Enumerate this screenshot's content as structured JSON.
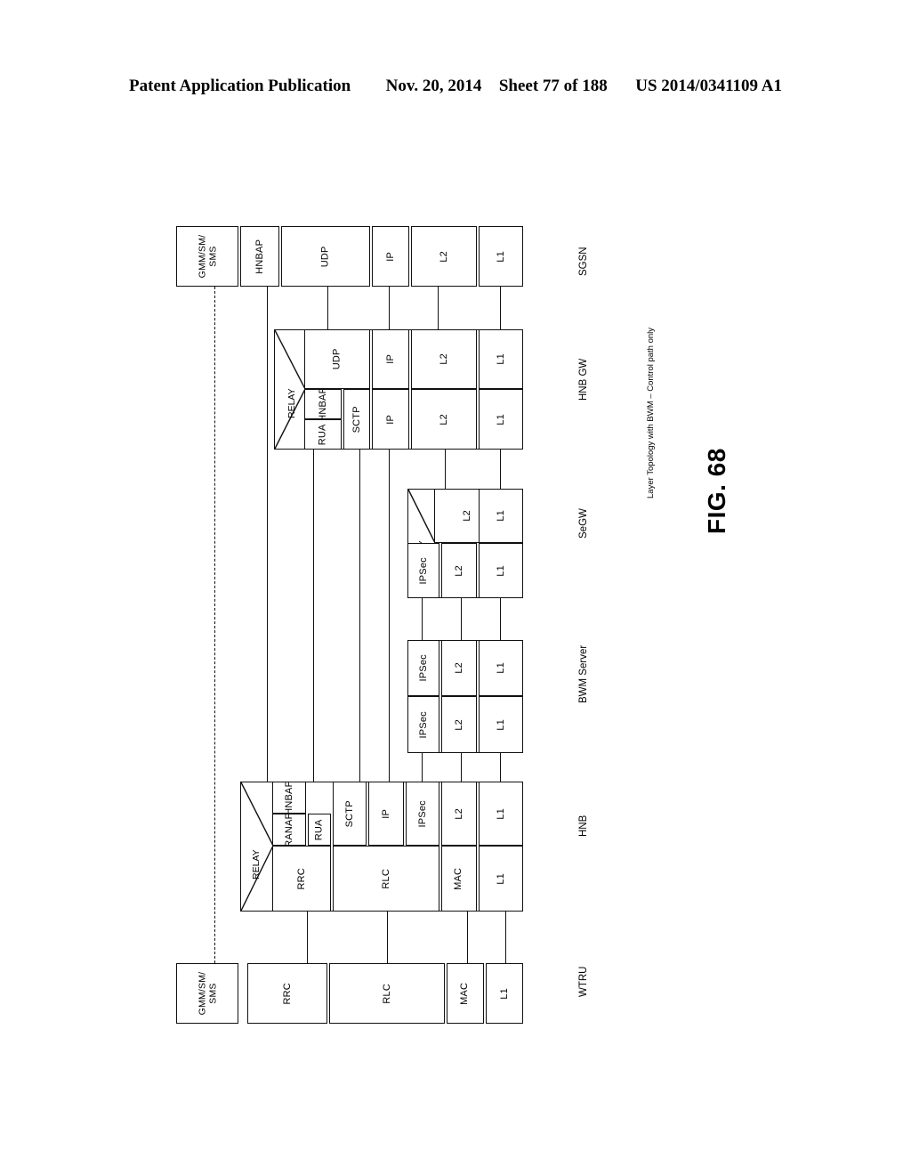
{
  "header": {
    "publication": "Patent Application Publication",
    "date": "Nov. 20, 2014",
    "sheet": "Sheet 77 of 188",
    "docnumber": "US 2014/0341109 A1"
  },
  "figure": {
    "number": "FIG. 68",
    "caption": "Layer Topology with BWM – Control path only",
    "relay_label": "RELAY"
  },
  "columns": [
    {
      "id": "sgsn",
      "label": "SGSN"
    },
    {
      "id": "hnbgw",
      "label": "HNB GW"
    },
    {
      "id": "segw",
      "label": "SeGW"
    },
    {
      "id": "bwmserver",
      "label": "BWM Server"
    },
    {
      "id": "hnb",
      "label": "HNB"
    },
    {
      "id": "wtru",
      "label": "WTRU"
    }
  ],
  "stacks": {
    "sgsn": {
      "row": [
        "GMM/SM/\nSMS",
        "HNBAP",
        "UDP",
        "IP",
        "L2",
        "L1"
      ]
    },
    "hnbgw": {
      "top": [
        "UDP",
        "IP",
        "L2",
        "L1"
      ],
      "bottom": [
        "HNBAP",
        "RUA",
        "SCTP",
        "IP",
        "L2",
        "L1"
      ]
    },
    "segw": {
      "top": [
        "L2",
        "L1"
      ],
      "bottom": [
        "IPSec",
        "L2",
        "L1"
      ]
    },
    "bwmserver": {
      "top": [
        "IPSec",
        "L2",
        "L1"
      ],
      "bottom": [
        "IPSec",
        "L2",
        "L1"
      ]
    },
    "hnb": {
      "top": [
        "HNBAP",
        "RANAP",
        "RUA",
        "SCTP",
        "IP",
        "IPSec",
        "L2",
        "L1"
      ],
      "bottom": [
        "RRC",
        "RLC",
        "MAC",
        "L1"
      ]
    },
    "wtru": {
      "row": [
        "GMM/SM/\nSMS",
        "RRC",
        "RLC",
        "MAC",
        "L1"
      ]
    }
  },
  "box_labels": {
    "gmm_sms": "GMM/SM/\nSMS",
    "hnbap": "HNBAP",
    "ranap": "RANAP",
    "rua": "RUA",
    "sctp": "SCTP",
    "udp": "UDP",
    "ip": "IP",
    "ipsec": "IPSec",
    "l2": "L2",
    "l1": "L1",
    "rrc": "RRC",
    "rlc": "RLC",
    "mac": "MAC"
  }
}
